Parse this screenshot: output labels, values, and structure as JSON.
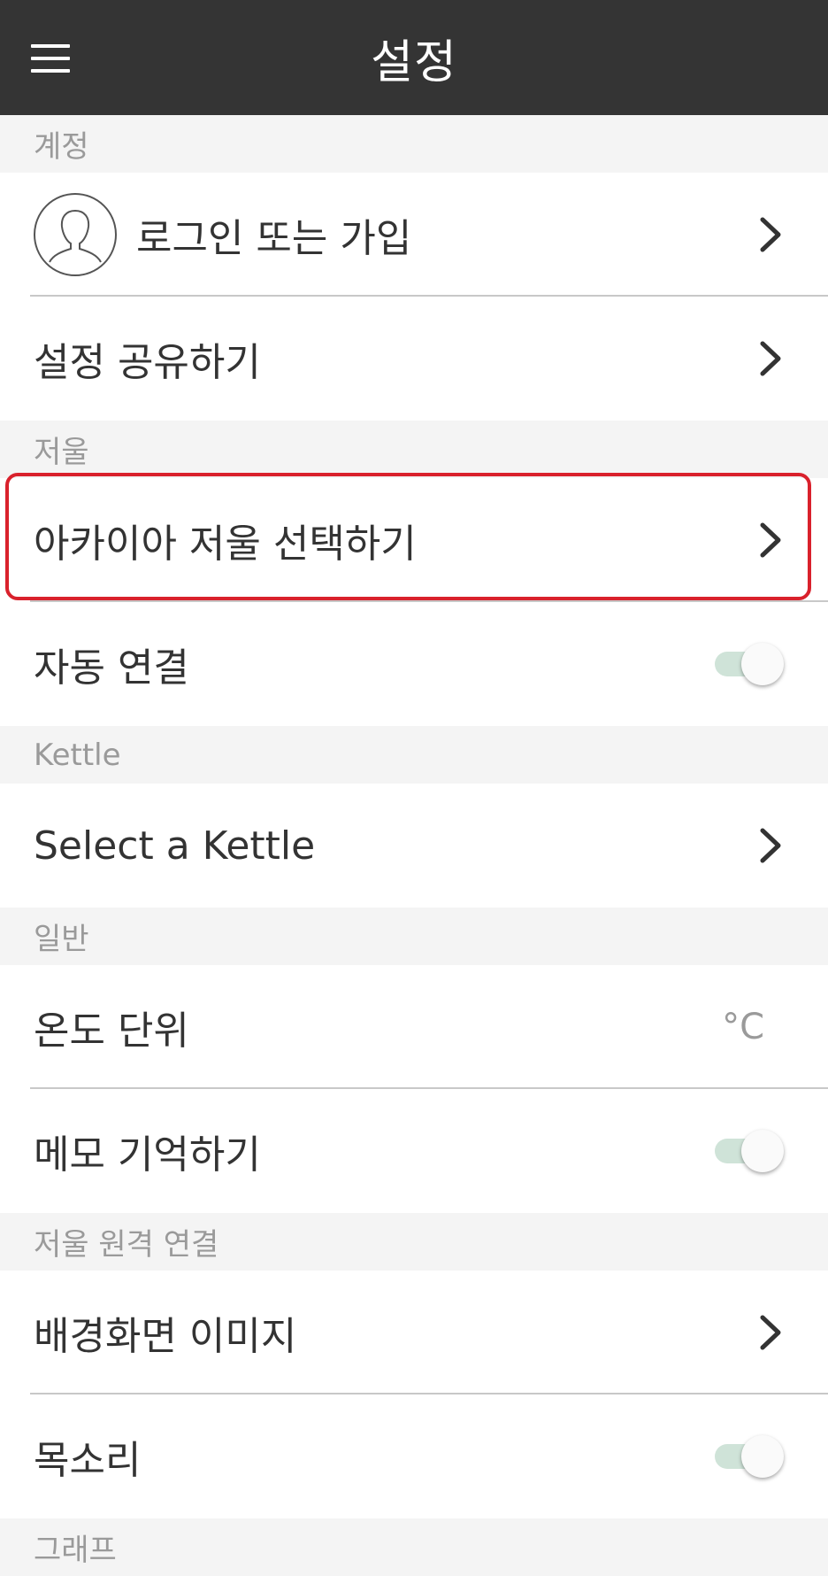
{
  "appbar": {
    "title": "설정",
    "menu_icon": "hamburger-menu-icon"
  },
  "sections": {
    "account": {
      "header": "계정",
      "login_label": "로그인 또는 가입",
      "share_label": "설정 공유하기"
    },
    "scale": {
      "header": "저울",
      "select_scale_label": "아카이아 저울 선택하기",
      "auto_connect_label": "자동 연결",
      "auto_connect_on": false
    },
    "kettle": {
      "header": "Kettle",
      "select_kettle_label": "Select a Kettle"
    },
    "general": {
      "header": "일반",
      "temp_unit_label": "온도 단위",
      "temp_unit_value": "°C",
      "remember_memo_label": "메모 기억하기",
      "remember_memo_on": false
    },
    "remote": {
      "header": "저울 원격 연결",
      "wallpaper_label": "배경화면 이미지",
      "voice_label": "목소리",
      "voice_on": false
    },
    "graph": {
      "header": "그래프"
    }
  },
  "colors": {
    "appbar": "#343434",
    "highlight": "#d9212c",
    "toggle_track": "#cfe3d8",
    "section_bg": "#f4f4f4"
  }
}
